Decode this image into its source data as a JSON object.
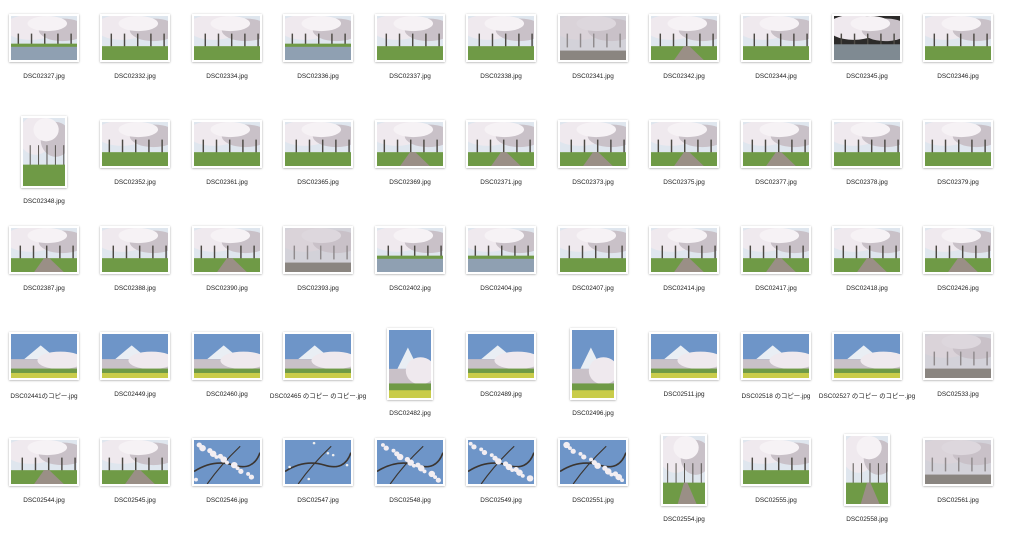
{
  "colors": {
    "sky": "#dfe6ee",
    "blossom": "#efe9ee",
    "blossom_shade": "#c9c1c8",
    "trunk": "#4d4a45",
    "grass": "#6f9a46",
    "path": "#9a8f86",
    "blue_sky": "#6e95c8",
    "mountain": "#e9eef4"
  },
  "rows": [
    [
      {
        "name": "DSC02327.jpg",
        "scene": "river"
      },
      {
        "name": "DSC02332.jpg",
        "scene": "trees"
      },
      {
        "name": "DSC02334.jpg",
        "scene": "trees"
      },
      {
        "name": "DSC02336.jpg",
        "scene": "river"
      },
      {
        "name": "DSC02337.jpg",
        "scene": "trees"
      },
      {
        "name": "DSC02338.jpg",
        "scene": "trees"
      },
      {
        "name": "DSC02341.jpg",
        "scene": "dense"
      },
      {
        "name": "DSC02342.jpg",
        "scene": "path"
      },
      {
        "name": "DSC02344.jpg",
        "scene": "trees"
      },
      {
        "name": "DSC02345.jpg",
        "scene": "dark"
      },
      {
        "name": "DSC02346.jpg",
        "scene": "trees"
      }
    ],
    [
      {
        "name": "DSC02348.jpg",
        "scene": "trees",
        "portrait": true
      },
      {
        "name": "DSC02352.jpg",
        "scene": "trees"
      },
      {
        "name": "DSC02361.jpg",
        "scene": "trees"
      },
      {
        "name": "DSC02365.jpg",
        "scene": "trees"
      },
      {
        "name": "DSC02369.jpg",
        "scene": "path"
      },
      {
        "name": "DSC02371.jpg",
        "scene": "path"
      },
      {
        "name": "DSC02373.jpg",
        "scene": "path"
      },
      {
        "name": "DSC02375.jpg",
        "scene": "path"
      },
      {
        "name": "DSC02377.jpg",
        "scene": "path"
      },
      {
        "name": "DSC02378.jpg",
        "scene": "trees"
      },
      {
        "name": "DSC02379.jpg",
        "scene": "trees"
      }
    ],
    [
      {
        "name": "DSC02387.jpg",
        "scene": "path"
      },
      {
        "name": "DSC02388.jpg",
        "scene": "trees"
      },
      {
        "name": "DSC02390.jpg",
        "scene": "path"
      },
      {
        "name": "DSC02393.jpg",
        "scene": "dense"
      },
      {
        "name": "DSC02402.jpg",
        "scene": "river"
      },
      {
        "name": "DSC02404.jpg",
        "scene": "river"
      },
      {
        "name": "DSC02407.jpg",
        "scene": "trees"
      },
      {
        "name": "DSC02414.jpg",
        "scene": "path"
      },
      {
        "name": "DSC02417.jpg",
        "scene": "path"
      },
      {
        "name": "DSC02418.jpg",
        "scene": "path"
      },
      {
        "name": "DSC02426.jpg",
        "scene": "path"
      }
    ],
    [
      {
        "name": "DSC02441のコピー.jpg",
        "scene": "fuji"
      },
      {
        "name": "DSC02449.jpg",
        "scene": "fuji"
      },
      {
        "name": "DSC02460.jpg",
        "scene": "fuji"
      },
      {
        "name": "DSC02465 のコピー のコピー.jpg",
        "scene": "fuji"
      },
      {
        "name": "DSC02482.jpg",
        "scene": "fuji",
        "portrait": true
      },
      {
        "name": "DSC02489.jpg",
        "scene": "fuji"
      },
      {
        "name": "DSC02496.jpg",
        "scene": "fuji",
        "portrait": true
      },
      {
        "name": "DSC02511.jpg",
        "scene": "fuji"
      },
      {
        "name": "DSC02518 のコピー.jpg",
        "scene": "fuji"
      },
      {
        "name": "DSC02527 のコピー のコピー.jpg",
        "scene": "fuji"
      },
      {
        "name": "DSC02533.jpg",
        "scene": "dense"
      }
    ],
    [
      {
        "name": "DSC02544.jpg",
        "scene": "path"
      },
      {
        "name": "DSC02545.jpg",
        "scene": "path"
      },
      {
        "name": "DSC02546.jpg",
        "scene": "flower"
      },
      {
        "name": "DSC02547.jpg",
        "scene": "branch"
      },
      {
        "name": "DSC02548.jpg",
        "scene": "flower"
      },
      {
        "name": "DSC02549.jpg",
        "scene": "flower"
      },
      {
        "name": "DSC02551.jpg",
        "scene": "flower"
      },
      {
        "name": "DSC02554.jpg",
        "scene": "path",
        "portrait": true
      },
      {
        "name": "DSC02555.jpg",
        "scene": "trees"
      },
      {
        "name": "DSC02558.jpg",
        "scene": "path",
        "portrait": true
      },
      {
        "name": "DSC02561.jpg",
        "scene": "dense"
      }
    ]
  ]
}
